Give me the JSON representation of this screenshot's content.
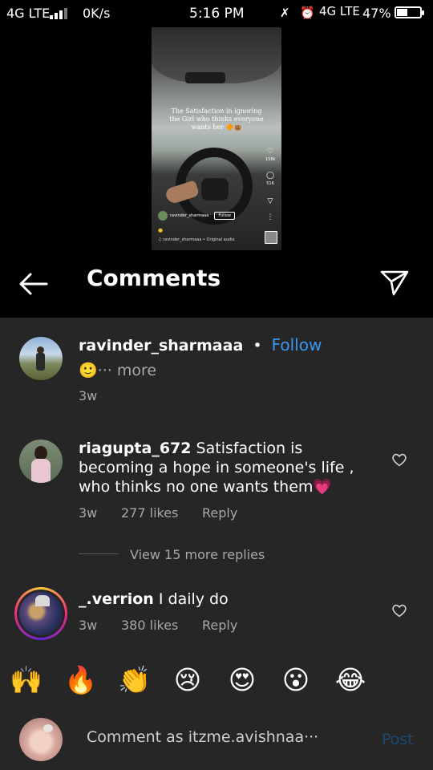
{
  "status_bar": {
    "network_left": "4G LTE",
    "speed": "0K/s",
    "time": "5:16 PM",
    "network_right": "4G LTE",
    "battery": "47%",
    "battery_level": 0.47
  },
  "preview": {
    "caption": "The Satisfaction in ignoring the Girl who thinks everyone wants her 🔶👜",
    "likes": "158k",
    "comments": "516",
    "username": "ravinder_sharmaaa",
    "follow": "Follow",
    "music": "♫ ravinder_sharmaaa • Original audio"
  },
  "header": {
    "title": "Comments",
    "back_icon": "back-arrow-icon",
    "share_icon": "send-icon"
  },
  "caption_post": {
    "username": "ravinder_sharmaaa",
    "dot": "•",
    "follow": "Follow",
    "text": "🙂··· more",
    "time": "3w",
    "follow_color": "#3897f0"
  },
  "comments": [
    {
      "username": "riagupta_672",
      "text": " Satisfaction is becoming a hope in someone's life , who thinks no one wants them",
      "emoji": "💗",
      "time": "3w",
      "likes": "277 likes",
      "reply": "Reply",
      "view_replies": "View 15 more replies"
    },
    {
      "username": "_.verrion",
      "text": " I daily do",
      "time": "3w",
      "likes": "380 likes",
      "reply": "Reply"
    }
  ],
  "quick_emojis": [
    "🙌",
    "🔥",
    "👏",
    "😢",
    "😍",
    "😮",
    "😂"
  ],
  "composer": {
    "placeholder": "Comment as itzme.avishnaa···",
    "post": "Post",
    "post_color": "#1a4a72"
  }
}
